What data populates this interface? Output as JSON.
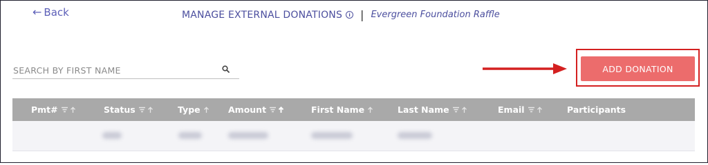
{
  "nav": {
    "back_label": "Back"
  },
  "header": {
    "title": "MANAGE EXTERNAL DONATIONS",
    "separator": "|",
    "subtitle": "Evergreen Foundation Raffle"
  },
  "search": {
    "placeholder": "SEARCH BY FIRST NAME",
    "value": ""
  },
  "actions": {
    "add_donation_label": "ADD DONATION"
  },
  "table": {
    "columns": [
      {
        "label": "Pmt#",
        "filter": true,
        "sort": "none"
      },
      {
        "label": "Status",
        "filter": true,
        "sort": "none"
      },
      {
        "label": "Type",
        "filter": false,
        "sort": "none"
      },
      {
        "label": "Amount",
        "filter": true,
        "sort": "ascending"
      },
      {
        "label": "First Name",
        "filter": false,
        "sort": "none"
      },
      {
        "label": "Last Name",
        "filter": true,
        "sort": "none"
      },
      {
        "label": "Email",
        "filter": true,
        "sort": "none"
      },
      {
        "label": "Participants",
        "filter": false,
        "sort": "none"
      }
    ],
    "rows_blurred": 1
  },
  "colors": {
    "accent": "#4b4e9e",
    "button": "#ec6c6c",
    "annotation": "#d42020",
    "table_header": "#a9a9a9"
  }
}
